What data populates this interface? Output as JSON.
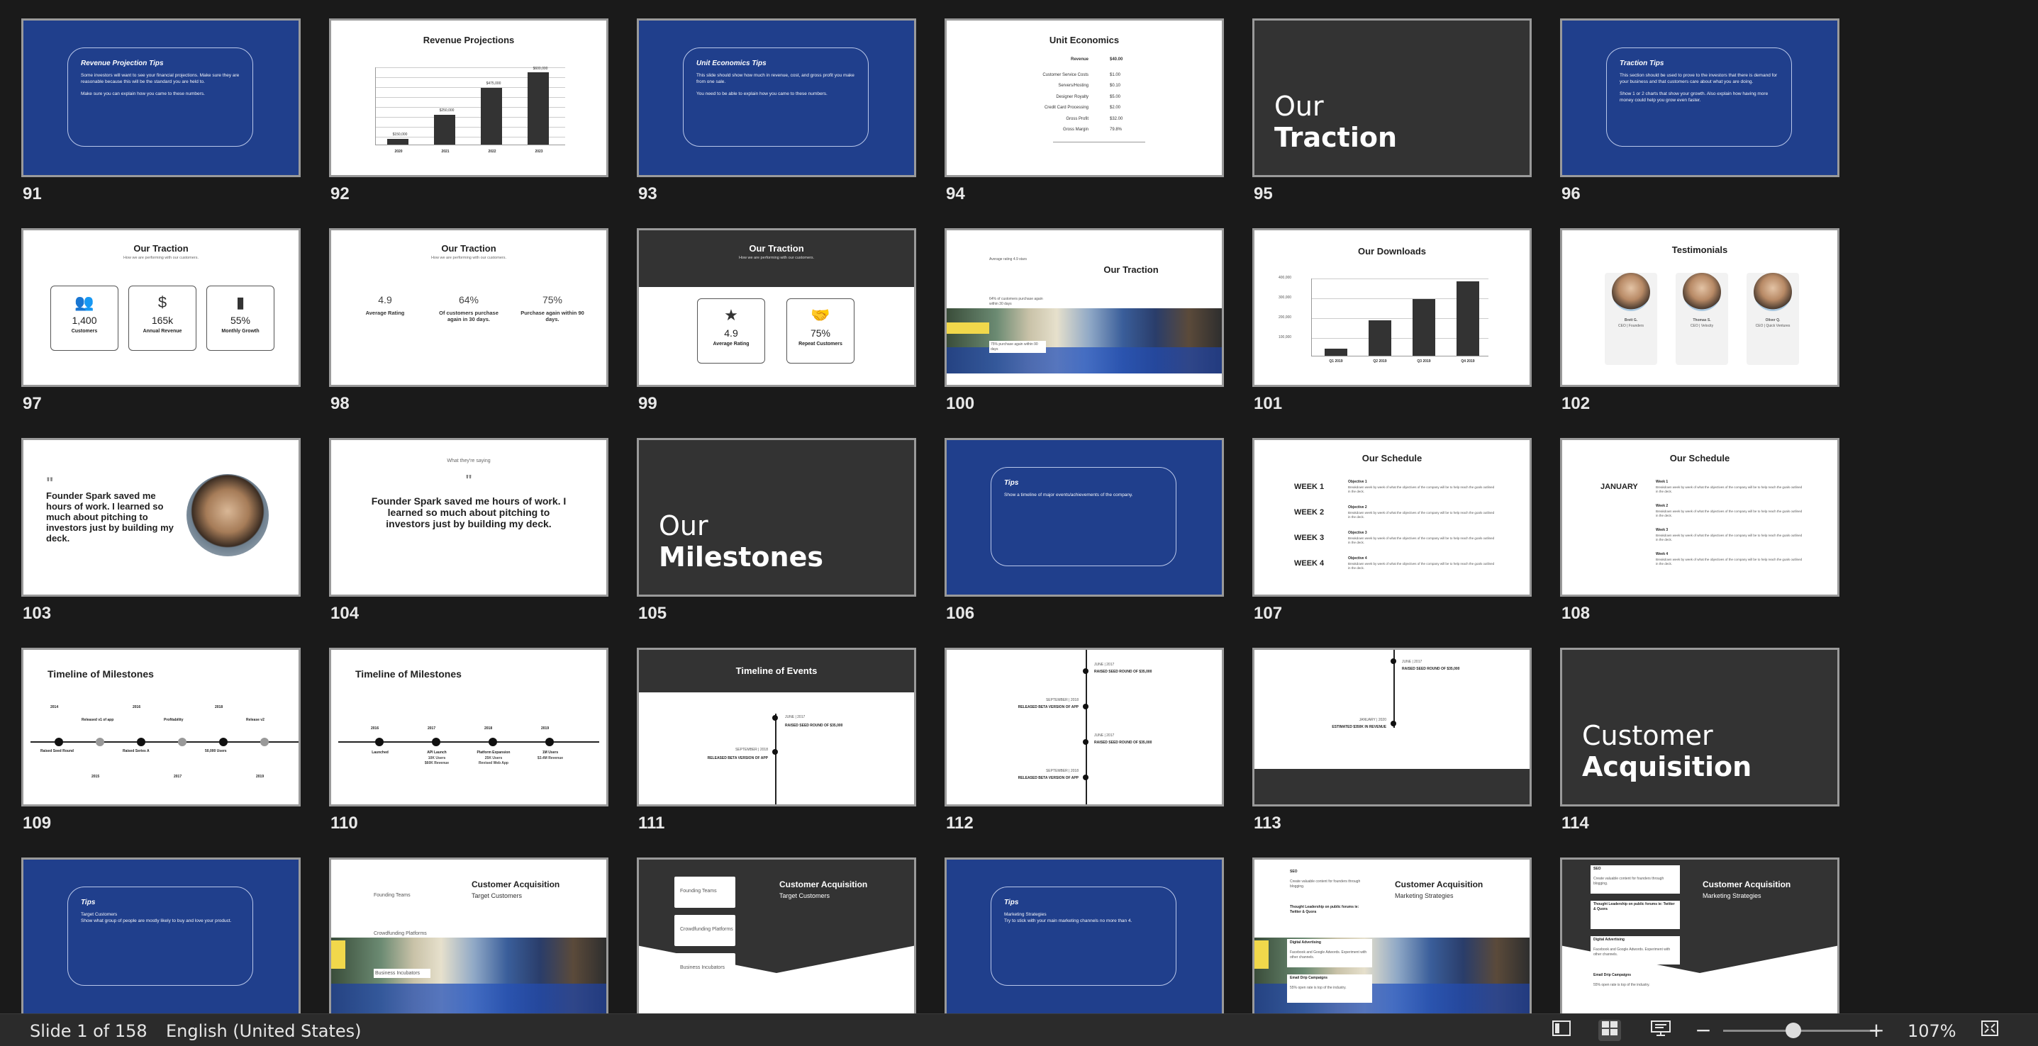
{
  "status_bar": {
    "slide_counter": "Slide 1 of 158",
    "language": "English (United States)",
    "zoom": "107%",
    "zoom_minus": "−",
    "zoom_plus": "+",
    "zoom_level_fraction": 0.45,
    "view_icons": [
      "normal-view-icon",
      "slide-sorter-icon",
      "reading-view-icon",
      "fit-to-window-icon"
    ]
  },
  "slides": [
    {
      "num": "91",
      "kind": "tips",
      "title": "Revenue Projection Tips",
      "body": "Some investors will want to see your financial projections. Make sure they are reasonable because this will be the standard you are held to.\n\nMake sure you can explain how you came to these numbers."
    },
    {
      "num": "92",
      "kind": "barchart",
      "title": "Revenue Projections",
      "categories": [
        "2020",
        "2021",
        "2022",
        "2023"
      ],
      "values": [
        50000,
        250000,
        475000,
        600000
      ],
      "labels": [
        "$150,000",
        "$250,000",
        "$475,000",
        "$600,000"
      ]
    },
    {
      "num": "93",
      "kind": "tips",
      "title": "Unit Economics Tips",
      "body": "This slide should show how much in revenue, cost, and gross profit you make from one sale.\n\nYou need to be able to explain how you came to these numbers."
    },
    {
      "num": "94",
      "kind": "uniteco",
      "title": "Unit Economics",
      "rows": [
        [
          "Revenue",
          "$40.00"
        ],
        [
          "Customer Service Costs",
          "$1.00"
        ],
        [
          "Servers/Hosting",
          "$0.10"
        ],
        [
          "Designer Royalty",
          "$5.00"
        ],
        [
          "Credit Card Processing",
          "$2.00"
        ],
        [
          "Gross Profit",
          "$32.00"
        ],
        [
          "Gross Margin",
          "79.8%"
        ]
      ]
    },
    {
      "num": "95",
      "kind": "section",
      "line1": "Our",
      "line2": "Traction"
    },
    {
      "num": "96",
      "kind": "tips",
      "title": "Traction Tips",
      "body": "This section should be used to prove to the investors that there is demand for your business and that customers care about what you are doing.\n\nShow 1 or 2 charts that show your growth. Also explain how having more money could help you grow even faster."
    },
    {
      "num": "97",
      "kind": "traction3",
      "title": "Our Traction",
      "subtitle": "How we are performing with our customers.",
      "items": [
        {
          "icon": "users-icon",
          "glyph": "👥",
          "value": "1,400",
          "label": "Customers"
        },
        {
          "icon": "dollar-cycle-icon",
          "glyph": "$",
          "value": "165k",
          "label": "Annual Revenue"
        },
        {
          "icon": "bar-chart-icon",
          "glyph": "▮",
          "value": "55%",
          "label": "Monthly Growth"
        }
      ]
    },
    {
      "num": "98",
      "kind": "traction-stats",
      "title": "Our Traction",
      "subtitle": "How we are performing with our customers.",
      "items": [
        {
          "value": "4.9",
          "label": "Average Rating"
        },
        {
          "value": "64%",
          "label": "Of customers purchase again in 30 days."
        },
        {
          "value": "75%",
          "label": "Purchase again within 90 days."
        }
      ]
    },
    {
      "num": "99",
      "kind": "traction-dark",
      "title": "Our Traction",
      "subtitle": "How we are performing with our customers.",
      "items": [
        {
          "icon": "star-icon",
          "glyph": "★",
          "value": "4.9",
          "label": "Average Rating"
        },
        {
          "icon": "handshake-icon",
          "glyph": "🤝",
          "value": "75%",
          "label": "Repeat Customers"
        }
      ]
    },
    {
      "num": "100",
      "kind": "traction-photo",
      "title": "Our Traction",
      "notes": [
        "Average rating 4.9 stars",
        "64% of customers purchase again within 30 days",
        "75% purchase again within 90 days"
      ]
    },
    {
      "num": "101",
      "kind": "downloads",
      "title": "Our Downloads",
      "categories": [
        "Q1 2019",
        "Q2 2019",
        "Q3 2019",
        "Q4 2019"
      ],
      "values": [
        40000,
        200000,
        320000,
        420000
      ],
      "yticks": [
        "400,000",
        "300,000",
        "200,000",
        "100,000"
      ]
    },
    {
      "num": "102",
      "kind": "testimonials",
      "title": "Testimonials",
      "people": [
        {
          "name": "Brett G.",
          "role": "CEO | Founders"
        },
        {
          "name": "Thomas S.",
          "role": "CEO | Velocity"
        },
        {
          "name": "Oliver Q.",
          "role": "CEO | Quick Ventures"
        }
      ]
    },
    {
      "num": "103",
      "kind": "quote-photo",
      "mark": "\"",
      "quote": "Founder Spark saved me hours of work. I learned so much about pitching to investors just by building my deck."
    },
    {
      "num": "104",
      "kind": "quote-center",
      "kicker": "What they're saying",
      "mark": "\"",
      "quote": "Founder Spark saved me hours of work. I learned so much about pitching to investors just by building my deck."
    },
    {
      "num": "105",
      "kind": "section",
      "line1": "Our",
      "line2": "Milestones"
    },
    {
      "num": "106",
      "kind": "tips",
      "title": "Tips",
      "body": "Show a timeline of major events/achievements of the company."
    },
    {
      "num": "107",
      "kind": "schedule",
      "title": "Our Schedule",
      "weeks": [
        "WEEK 1",
        "WEEK 2",
        "WEEK 3",
        "WEEK 4"
      ],
      "objectives": [
        "Objective 1",
        "Objective 2",
        "Objective 3",
        "Objective 4"
      ],
      "desc": "Breakdown week by week of what the objectives of the company will be to help reach the goals outlined in the deck."
    },
    {
      "num": "108",
      "kind": "schedule-month",
      "title": "Our Schedule",
      "month": "JANUARY",
      "weeks": [
        "Week 1",
        "Week 2",
        "Week 3",
        "Week 4"
      ],
      "desc": "Breakdown week by week of what the objectives of the company will be to help reach the goals outlined in the deck."
    },
    {
      "num": "109",
      "kind": "timeline1",
      "title": "Timeline of Milestones",
      "top": [
        {
          "y": "2014",
          "t": ""
        },
        {
          "y": "",
          "t": "Released v1 of app"
        },
        {
          "y": "2016",
          "t": ""
        },
        {
          "y": "",
          "t": "Profitability"
        },
        {
          "y": "2018",
          "t": ""
        },
        {
          "y": "",
          "t": "Release v2"
        }
      ],
      "bottom": [
        {
          "y": "",
          "t": "Raised Seed Round"
        },
        {
          "y": "2015",
          "t": ""
        },
        {
          "y": "",
          "t": "Raised Series A"
        },
        {
          "y": "2017",
          "t": ""
        },
        {
          "y": "",
          "t": "50,000 Users"
        },
        {
          "y": "2019",
          "t": ""
        }
      ]
    },
    {
      "num": "110",
      "kind": "timeline2",
      "title": "Timeline of Milestones",
      "points": [
        {
          "y": "2016",
          "t": "Launched",
          "s": ""
        },
        {
          "y": "2017",
          "t": "API Launch",
          "s": "10K Users\n$60K Revenue"
        },
        {
          "y": "2018",
          "t": "Platform Expansion",
          "s": "25K Users\nRevised Web App"
        },
        {
          "y": "2019",
          "t": "1M Users",
          "s": "$3.4M Revenue"
        }
      ]
    },
    {
      "num": "111",
      "kind": "events",
      "title": "Timeline of Events",
      "events": [
        {
          "d": "JUNE | 2017",
          "t": "RAISED SEED ROUND OF $35,000"
        },
        {
          "d": "SEPTEMBER | 2018",
          "t": "RELEASED BETA VERSION OF APP"
        }
      ]
    },
    {
      "num": "112",
      "kind": "events-long",
      "events": [
        {
          "d": "JUNE | 2017",
          "t": "RAISED SEED ROUND OF $35,000"
        },
        {
          "d": "SEPTEMBER | 2018",
          "t": "RELEASED BETA VERSION OF APP"
        },
        {
          "d": "JUNE | 2017",
          "t": "RAISED SEED ROUND OF $35,000"
        },
        {
          "d": "SEPTEMBER | 2018",
          "t": "RELEASED BETA VERSION OF APP"
        }
      ]
    },
    {
      "num": "113",
      "kind": "events-dark",
      "events": [
        {
          "d": "JUNE | 2017",
          "t": "RAISED SEED ROUND OF $35,000"
        },
        {
          "d": "JANUARY | 2020",
          "t": "ESTIMATED $350K IN REVENUE"
        }
      ]
    },
    {
      "num": "114",
      "kind": "section",
      "line1": "Customer",
      "line2": "Acquisition"
    },
    {
      "num": "115",
      "kind": "tips",
      "title": "Tips",
      "body": "Target Customers\nShow what group of people are mostly likely to buy and love your product."
    },
    {
      "num": "116",
      "kind": "ca-photo",
      "title": "Customer Acquisition",
      "subtitle": "Target Customers",
      "items": [
        "Founding Teams",
        "Crowdfunding Platforms",
        "Business Incubators"
      ]
    },
    {
      "num": "117",
      "kind": "ca-dark",
      "title": "Customer Acquisition",
      "subtitle": "Target Customers",
      "items": [
        "Founding Teams",
        "Crowdfunding Platforms",
        "Business Incubators"
      ]
    },
    {
      "num": "118",
      "kind": "tips",
      "title": "Tips",
      "body": "Marketing Strategies\nTry to stick with your main marketing channels no more than 4."
    },
    {
      "num": "119",
      "kind": "ms-photo",
      "title": "Customer Acquisition",
      "subtitle": "Marketing Strategies",
      "items": [
        {
          "h": "SEO",
          "b": "Create valuable content for founders through blogging."
        },
        {
          "h": "Thought Leadership on public forums ie: Twitter & Quora",
          "b": ""
        },
        {
          "h": "Digital Advertising",
          "b": "Facebook and Google Adwords. Experiment with other channels."
        },
        {
          "h": "Email Drip Campaigns",
          "b": "55% open rate is top of the industry."
        }
      ]
    },
    {
      "num": "120",
      "kind": "ms-dark",
      "title": "Customer Acquisition",
      "subtitle": "Marketing Strategies",
      "items": [
        {
          "h": "SEO",
          "b": "Create valuable content for founders through blogging."
        },
        {
          "h": "Thought Leadership on public forums ie: Twitter & Quora",
          "b": ""
        },
        {
          "h": "Digital Advertising",
          "b": "Facebook and Google Adwords. Experiment with other channels."
        },
        {
          "h": "Email Drip Campaigns",
          "b": "55% open rate is top of the industry."
        }
      ]
    }
  ]
}
